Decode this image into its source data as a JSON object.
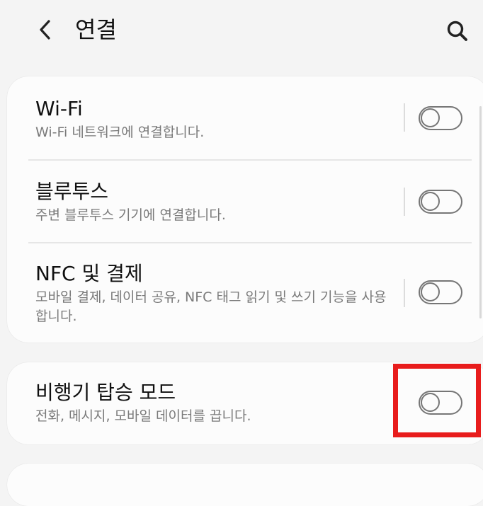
{
  "header": {
    "title": "연결"
  },
  "settings": {
    "wifi": {
      "title": "Wi-Fi",
      "subtitle": "Wi-Fi 네트워크에 연결합니다."
    },
    "bluetooth": {
      "title": "블루투스",
      "subtitle": "주변 블루투스 기기에 연결합니다."
    },
    "nfc": {
      "title": "NFC 및 결제",
      "subtitle": "모바일 결제, 데이터 공유, NFC 태그 읽기 및 쓰기 기능을 사용합니다."
    },
    "airplane": {
      "title": "비행기 탑승 모드",
      "subtitle": "전화, 메시지, 모바일 데이터를 끕니다."
    }
  },
  "colors": {
    "highlight": "#e81c1c",
    "toggle_off": "#767676"
  },
  "icons": {
    "back": "back-arrow-icon",
    "search": "search-icon"
  }
}
